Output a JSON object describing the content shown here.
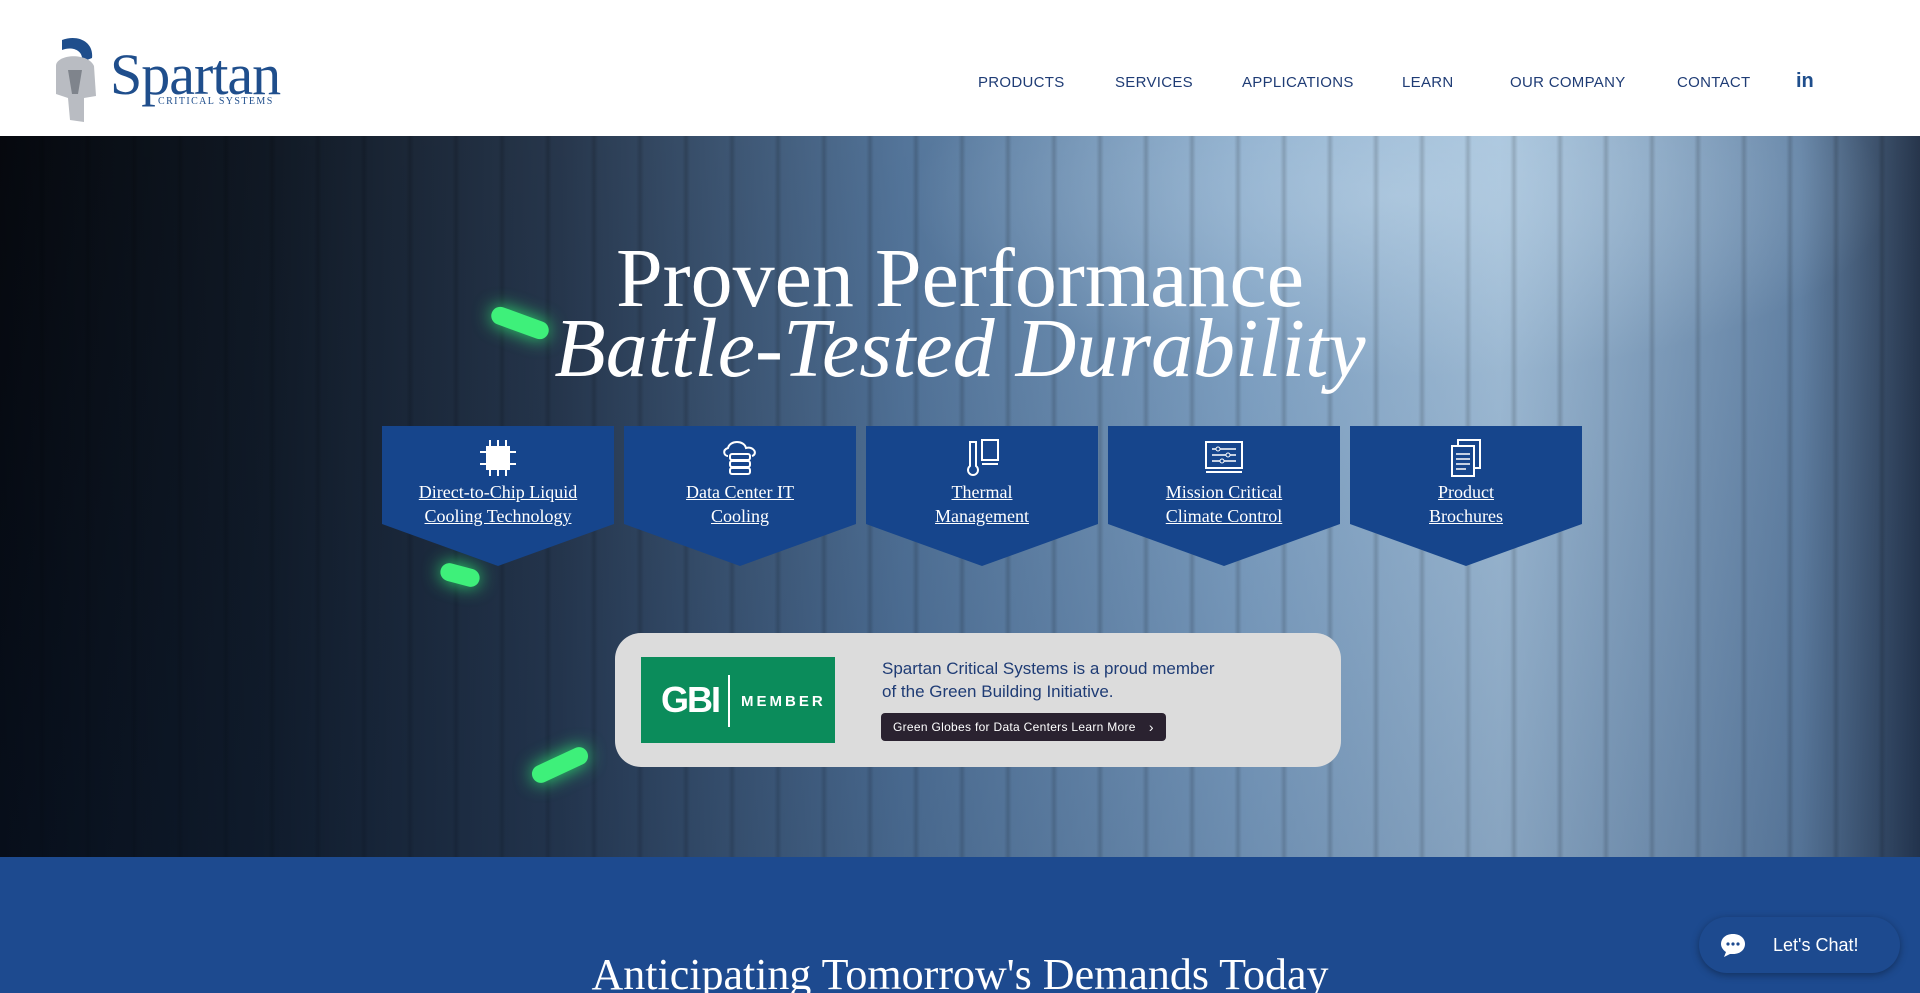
{
  "brand": {
    "name": "Spartan",
    "subtitle": "CRITICAL SYSTEMS"
  },
  "nav": {
    "items": [
      "PRODUCTS",
      "SERVICES",
      "APPLICATIONS",
      "LEARN",
      "OUR COMPANY",
      "CONTACT"
    ],
    "linkedin_label": "in"
  },
  "hero": {
    "title_line1": "Proven Performance",
    "title_line2": "Battle-Tested Durability",
    "cards": [
      {
        "line1": "Direct-to-Chip Liquid",
        "line2": "Cooling Technology",
        "icon": "chip-icon"
      },
      {
        "line1": "Data Center IT",
        "line2": "Cooling",
        "icon": "cloud-server-icon"
      },
      {
        "line1": "Thermal",
        "line2": "Management",
        "icon": "thermometer-icon"
      },
      {
        "line1": "Mission Critical",
        "line2": "Climate Control",
        "icon": "control-panel-icon"
      },
      {
        "line1": "Product",
        "line2": "Brochures",
        "icon": "document-icon"
      }
    ]
  },
  "gbi": {
    "logo_text": "GBI",
    "logo_member": "MEMBER",
    "text_line1": "Spartan Critical Systems is a proud member",
    "text_line2": "of the Green Building Initiative.",
    "button_label": "Green Globes for Data Centers Learn More"
  },
  "section2": {
    "title": "Anticipating Tomorrow's Demands Today"
  },
  "chat": {
    "label": "Let's Chat!"
  },
  "colors": {
    "brand_blue": "#1f4e8c",
    "card_blue": "#16458c",
    "gbi_green": "#0b8c5b",
    "section_blue": "#1d4a8f"
  }
}
